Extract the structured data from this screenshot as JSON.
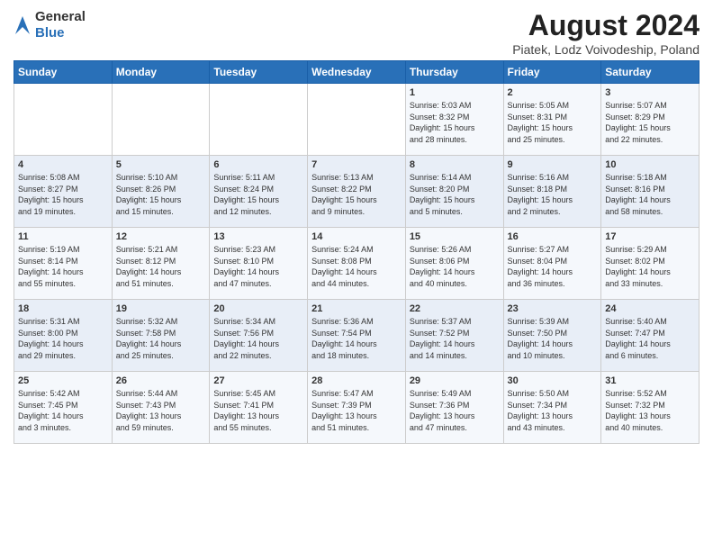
{
  "logo": {
    "text_general": "General",
    "text_blue": "Blue"
  },
  "title": "August 2024",
  "subtitle": "Piatek, Lodz Voivodeship, Poland",
  "days_of_week": [
    "Sunday",
    "Monday",
    "Tuesday",
    "Wednesday",
    "Thursday",
    "Friday",
    "Saturday"
  ],
  "weeks": [
    [
      {
        "day": "",
        "info": ""
      },
      {
        "day": "",
        "info": ""
      },
      {
        "day": "",
        "info": ""
      },
      {
        "day": "",
        "info": ""
      },
      {
        "day": "1",
        "info": "Sunrise: 5:03 AM\nSunset: 8:32 PM\nDaylight: 15 hours\nand 28 minutes."
      },
      {
        "day": "2",
        "info": "Sunrise: 5:05 AM\nSunset: 8:31 PM\nDaylight: 15 hours\nand 25 minutes."
      },
      {
        "day": "3",
        "info": "Sunrise: 5:07 AM\nSunset: 8:29 PM\nDaylight: 15 hours\nand 22 minutes."
      }
    ],
    [
      {
        "day": "4",
        "info": "Sunrise: 5:08 AM\nSunset: 8:27 PM\nDaylight: 15 hours\nand 19 minutes."
      },
      {
        "day": "5",
        "info": "Sunrise: 5:10 AM\nSunset: 8:26 PM\nDaylight: 15 hours\nand 15 minutes."
      },
      {
        "day": "6",
        "info": "Sunrise: 5:11 AM\nSunset: 8:24 PM\nDaylight: 15 hours\nand 12 minutes."
      },
      {
        "day": "7",
        "info": "Sunrise: 5:13 AM\nSunset: 8:22 PM\nDaylight: 15 hours\nand 9 minutes."
      },
      {
        "day": "8",
        "info": "Sunrise: 5:14 AM\nSunset: 8:20 PM\nDaylight: 15 hours\nand 5 minutes."
      },
      {
        "day": "9",
        "info": "Sunrise: 5:16 AM\nSunset: 8:18 PM\nDaylight: 15 hours\nand 2 minutes."
      },
      {
        "day": "10",
        "info": "Sunrise: 5:18 AM\nSunset: 8:16 PM\nDaylight: 14 hours\nand 58 minutes."
      }
    ],
    [
      {
        "day": "11",
        "info": "Sunrise: 5:19 AM\nSunset: 8:14 PM\nDaylight: 14 hours\nand 55 minutes."
      },
      {
        "day": "12",
        "info": "Sunrise: 5:21 AM\nSunset: 8:12 PM\nDaylight: 14 hours\nand 51 minutes."
      },
      {
        "day": "13",
        "info": "Sunrise: 5:23 AM\nSunset: 8:10 PM\nDaylight: 14 hours\nand 47 minutes."
      },
      {
        "day": "14",
        "info": "Sunrise: 5:24 AM\nSunset: 8:08 PM\nDaylight: 14 hours\nand 44 minutes."
      },
      {
        "day": "15",
        "info": "Sunrise: 5:26 AM\nSunset: 8:06 PM\nDaylight: 14 hours\nand 40 minutes."
      },
      {
        "day": "16",
        "info": "Sunrise: 5:27 AM\nSunset: 8:04 PM\nDaylight: 14 hours\nand 36 minutes."
      },
      {
        "day": "17",
        "info": "Sunrise: 5:29 AM\nSunset: 8:02 PM\nDaylight: 14 hours\nand 33 minutes."
      }
    ],
    [
      {
        "day": "18",
        "info": "Sunrise: 5:31 AM\nSunset: 8:00 PM\nDaylight: 14 hours\nand 29 minutes."
      },
      {
        "day": "19",
        "info": "Sunrise: 5:32 AM\nSunset: 7:58 PM\nDaylight: 14 hours\nand 25 minutes."
      },
      {
        "day": "20",
        "info": "Sunrise: 5:34 AM\nSunset: 7:56 PM\nDaylight: 14 hours\nand 22 minutes."
      },
      {
        "day": "21",
        "info": "Sunrise: 5:36 AM\nSunset: 7:54 PM\nDaylight: 14 hours\nand 18 minutes."
      },
      {
        "day": "22",
        "info": "Sunrise: 5:37 AM\nSunset: 7:52 PM\nDaylight: 14 hours\nand 14 minutes."
      },
      {
        "day": "23",
        "info": "Sunrise: 5:39 AM\nSunset: 7:50 PM\nDaylight: 14 hours\nand 10 minutes."
      },
      {
        "day": "24",
        "info": "Sunrise: 5:40 AM\nSunset: 7:47 PM\nDaylight: 14 hours\nand 6 minutes."
      }
    ],
    [
      {
        "day": "25",
        "info": "Sunrise: 5:42 AM\nSunset: 7:45 PM\nDaylight: 14 hours\nand 3 minutes."
      },
      {
        "day": "26",
        "info": "Sunrise: 5:44 AM\nSunset: 7:43 PM\nDaylight: 13 hours\nand 59 minutes."
      },
      {
        "day": "27",
        "info": "Sunrise: 5:45 AM\nSunset: 7:41 PM\nDaylight: 13 hours\nand 55 minutes."
      },
      {
        "day": "28",
        "info": "Sunrise: 5:47 AM\nSunset: 7:39 PM\nDaylight: 13 hours\nand 51 minutes."
      },
      {
        "day": "29",
        "info": "Sunrise: 5:49 AM\nSunset: 7:36 PM\nDaylight: 13 hours\nand 47 minutes."
      },
      {
        "day": "30",
        "info": "Sunrise: 5:50 AM\nSunset: 7:34 PM\nDaylight: 13 hours\nand 43 minutes."
      },
      {
        "day": "31",
        "info": "Sunrise: 5:52 AM\nSunset: 7:32 PM\nDaylight: 13 hours\nand 40 minutes."
      }
    ]
  ]
}
